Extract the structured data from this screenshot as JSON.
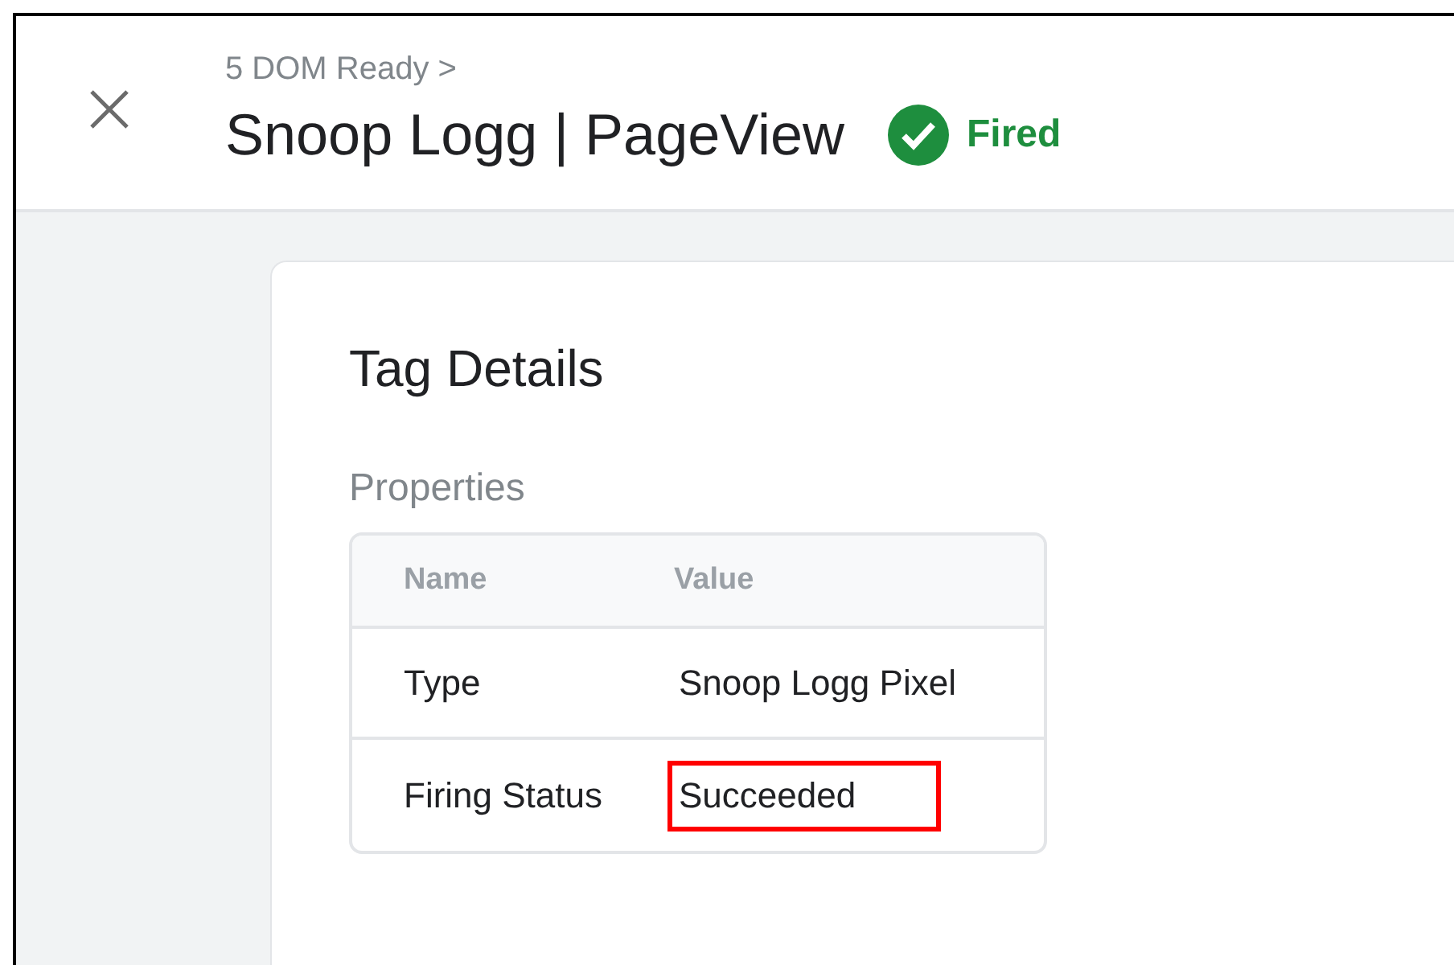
{
  "header": {
    "breadcrumb": "5 DOM Ready >",
    "title": "Snoop Logg | PageView",
    "status": {
      "label": "Fired",
      "kind": "success"
    }
  },
  "card": {
    "title": "Tag Details",
    "section": "Properties",
    "table": {
      "columns": [
        "Name",
        "Value"
      ],
      "rows": [
        {
          "name": "Type",
          "value": "Snoop Logg Pixel",
          "highlighted": false
        },
        {
          "name": "Firing Status",
          "value": "Succeeded",
          "highlighted": true
        }
      ]
    }
  }
}
